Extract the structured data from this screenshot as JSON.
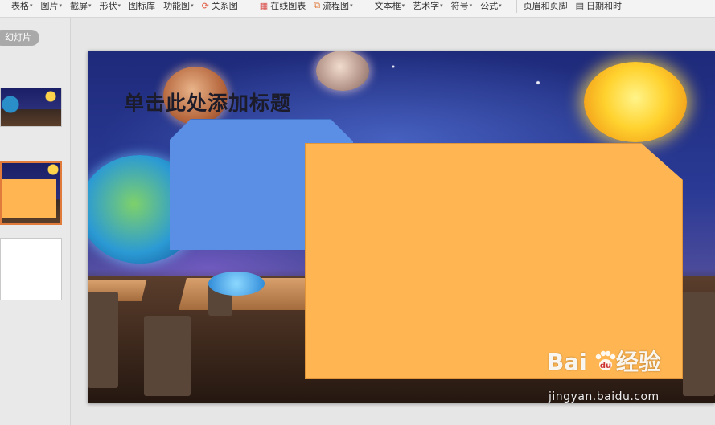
{
  "toolbar": {
    "items": [
      {
        "label": "表格",
        "dropdown": true
      },
      {
        "label": "图片",
        "dropdown": true
      },
      {
        "label": "截屏",
        "dropdown": true
      },
      {
        "label": "形状",
        "dropdown": true
      },
      {
        "label": "图标库",
        "dropdown": false
      },
      {
        "label": "功能图",
        "dropdown": true
      },
      {
        "label": "关系图",
        "dropdown": false
      },
      {
        "label": "在线图表",
        "dropdown": false
      },
      {
        "label": "流程图",
        "dropdown": true
      },
      {
        "label": "文本框",
        "dropdown": true
      },
      {
        "label": "艺术字",
        "dropdown": true
      },
      {
        "label": "符号",
        "dropdown": true
      },
      {
        "label": "公式",
        "dropdown": true
      },
      {
        "label": "页眉和页脚",
        "dropdown": false
      },
      {
        "label": "日期和时",
        "dropdown": false
      }
    ]
  },
  "left_panel": {
    "tab_label": "幻灯片"
  },
  "slide": {
    "title": "单击此处添加标题"
  },
  "watermark": {
    "logo_left": "Bai",
    "logo_right": "经验",
    "url": "jingyan.baidu.com"
  },
  "colors": {
    "blue_shape": "#5b8fe6",
    "orange_shape": "#ffb652",
    "selected_thumb_border": "#e07b3c"
  }
}
